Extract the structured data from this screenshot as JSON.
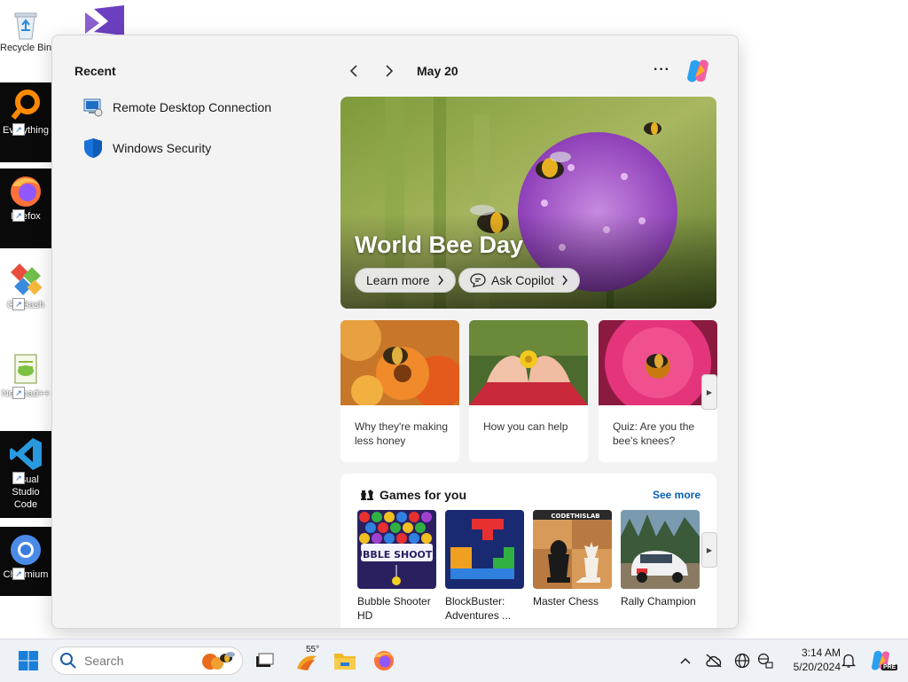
{
  "desktop": {
    "icons": [
      {
        "label": "Recycle Bin"
      },
      {
        "label": "Everything"
      },
      {
        "label": "Firefox"
      },
      {
        "label": "Git Bash"
      },
      {
        "label": "Notepad++"
      },
      {
        "label": "Visual Studio Code"
      },
      {
        "label": "Chromium"
      }
    ]
  },
  "flyout": {
    "recent_title": "Recent",
    "recent_items": [
      {
        "label": "Remote Desktop Connection",
        "icon": "remote-desktop-icon"
      },
      {
        "label": "Windows Security",
        "icon": "shield-icon"
      }
    ],
    "date": "May 20",
    "more": "···",
    "hero": {
      "title": "World Bee Day",
      "learn_more": "Learn more",
      "ask_copilot": "Ask Copilot"
    },
    "cards": [
      {
        "text": "Why they're making less honey"
      },
      {
        "text": "How you can help"
      },
      {
        "text": "Quiz: Are you the bee's knees?"
      }
    ],
    "games": {
      "title": "Games for you",
      "see_more": "See more",
      "items": [
        {
          "name": "Bubble Shooter HD",
          "thumb_text": "BUBBLE SHOOTER"
        },
        {
          "name": "BlockBuster: Adventures ..."
        },
        {
          "name": "Master Chess",
          "thumb_text": "CODETHISLAB"
        },
        {
          "name": "Rally Champion"
        }
      ]
    }
  },
  "taskbar": {
    "search_placeholder": "Search",
    "weather": "55°",
    "time": "3:14 AM",
    "date": "5/20/2024",
    "copilot_badge": "PRE"
  },
  "colors": {
    "accent": "#0a5fb4",
    "flyout_bg": "#f3f3f3",
    "taskbar_bg": "#eef1f6",
    "windows_blue": "#0078d4"
  }
}
